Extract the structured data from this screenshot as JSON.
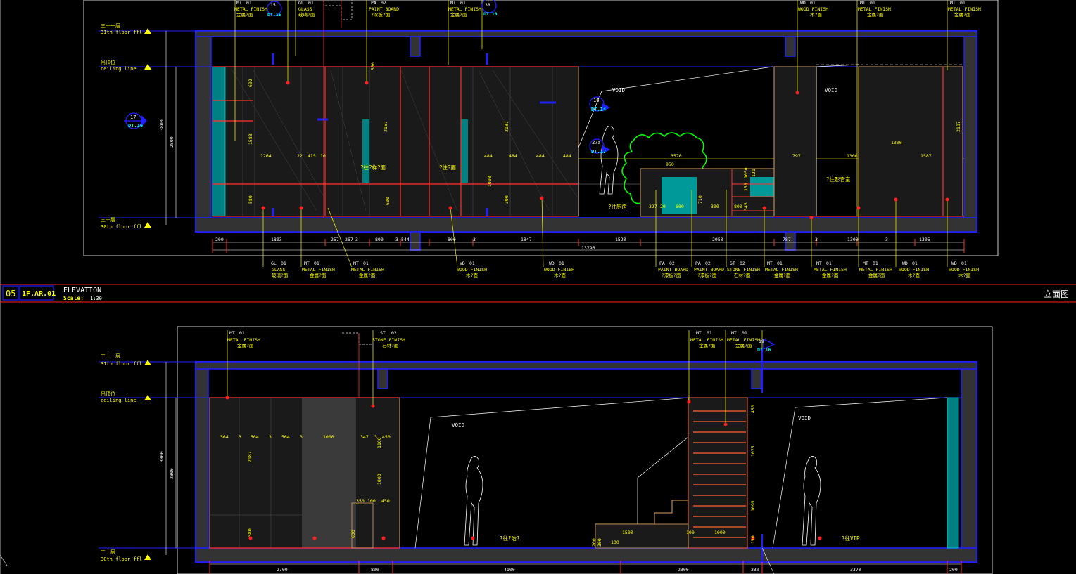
{
  "title_bar": {
    "number": "05",
    "sheet_code": "1F.AR.01",
    "title": "ELEVATION",
    "scale_label": "Scale:",
    "scale_value": "1:30",
    "right_label": "立面图"
  },
  "level_labels": {
    "floor31_cn": "三十一层",
    "floor31_en": "31th floor ffl",
    "ceiling_cn": "吊顶位",
    "ceiling_en": "ceiling line",
    "floor30_cn": "三十层",
    "floor30_en": "30th floor ffl"
  },
  "top": {
    "tags_top": [
      {
        "code": "MT",
        "num": "01",
        "en": "METAL FINISH",
        "cn": "金属?面"
      },
      {
        "code": "15",
        "num": "",
        "en": "DT.15",
        "cn": ""
      },
      {
        "code": "GL",
        "num": "01",
        "en": "GLASS",
        "cn": "玻璃?面"
      },
      {
        "code": "PA",
        "num": "02",
        "en": "PAINT BOARD",
        "cn": "?漆板?面"
      },
      {
        "code": "MT",
        "num": "01",
        "en": "METAL FINISH",
        "cn": "金属?面"
      },
      {
        "code": "38",
        "num": "",
        "en": "DT.19",
        "cn": ""
      },
      {
        "code": "WD",
        "num": "01",
        "en": "WOOD FINISH",
        "cn": "木?面"
      },
      {
        "code": "MT",
        "num": "01",
        "en": "METAL FINISH",
        "cn": "金属?面"
      },
      {
        "code": "MT",
        "num": "01",
        "en": "METAL FINISH",
        "cn": "金属?面"
      }
    ],
    "tags_bottom": [
      {
        "code": "GL",
        "num": "01",
        "en": "GLASS",
        "cn": "玻璃?面"
      },
      {
        "code": "MT",
        "num": "01",
        "en": "METAL FINISH",
        "cn": "金属?面"
      },
      {
        "code": "MT",
        "num": "01",
        "en": "METAL FINISH",
        "cn": "金属?面"
      },
      {
        "code": "WD",
        "num": "01",
        "en": "WOOD FINISH",
        "cn": "木?面"
      },
      {
        "code": "WD",
        "num": "01",
        "en": "WOOD FINISH",
        "cn": "木?面"
      },
      {
        "code": "PA",
        "num": "02",
        "en": "PAINT BOARD",
        "cn": "?漆板?面"
      },
      {
        "code": "PA",
        "num": "02",
        "en": "PAINT BOARD",
        "cn": "?漆板?面"
      },
      {
        "code": "ST",
        "num": "02",
        "en": "STONE FINISH",
        "cn": "石材?面"
      },
      {
        "code": "MT",
        "num": "01",
        "en": "METAL FINISH",
        "cn": "金属?面"
      },
      {
        "code": "MT",
        "num": "01",
        "en": "METAL FINISH",
        "cn": "金属?面"
      },
      {
        "code": "MT",
        "num": "01",
        "en": "METAL FINISH",
        "cn": "金属?面"
      },
      {
        "code": "WD",
        "num": "01",
        "en": "WOOD FINISH",
        "cn": "木?面"
      },
      {
        "code": "WD",
        "num": "01",
        "en": "WOOD FINISH",
        "cn": "木?面"
      }
    ],
    "section_marks": [
      {
        "num": "17",
        "ref": "DT.16"
      },
      {
        "num": "16",
        "ref": "DT.14"
      },
      {
        "num": "27a",
        "ref": "DT.17"
      }
    ],
    "dims_bottom": [
      "200",
      "1803",
      "257",
      "267",
      "3",
      "800",
      "3",
      "544",
      "800",
      "3",
      "1847",
      "1520",
      "2050",
      "787",
      "3",
      "1300",
      "3",
      "1305"
    ],
    "overall_dim": "13796",
    "left_dims": [
      "3800",
      "2800"
    ],
    "inner_dims": [
      "602",
      "1588",
      "1264",
      "22",
      "415",
      "10",
      "2157",
      "2187",
      "484",
      "484",
      "484",
      "484",
      "3570",
      "950",
      "797",
      "1300",
      "1300",
      "1587",
      "2187",
      "1000",
      "300",
      "580",
      "600",
      "530",
      "327",
      "20",
      "600",
      "710",
      "300",
      "800",
      "345",
      "150",
      "1050",
      "121"
    ],
    "void_labels": [
      "VOID",
      "VOID"
    ],
    "room_labels": [
      "?往?梯?面",
      "?往?面",
      "?往厨房",
      "?往影音室"
    ]
  },
  "bottom": {
    "tags_top": [
      {
        "code": "MT",
        "num": "01",
        "en": "METAL FINISH",
        "cn": "金属?面"
      },
      {
        "code": "ST",
        "num": "02",
        "en": "STONE FINISH",
        "cn": "石材?面"
      },
      {
        "code": "MT",
        "num": "01",
        "en": "METAL FINISH",
        "cn": "金属?面"
      },
      {
        "code": "MT",
        "num": "01",
        "en": "METAL FINISH",
        "cn": "金属?面"
      },
      {
        "code": "19",
        "num": "",
        "en": "DT.16",
        "cn": ""
      }
    ],
    "dims_bottom": [
      "2700",
      "800",
      "4100",
      "2300",
      "330",
      "3370",
      "200"
    ],
    "left_dims": [
      "3800",
      "2800"
    ],
    "inner_dims": [
      "564",
      "3",
      "564",
      "3",
      "564",
      "3",
      "1000",
      "347",
      "3",
      "450",
      "2187",
      "1100",
      "1800",
      "350",
      "100",
      "450",
      "580",
      "600",
      "450",
      "1075",
      "1095",
      "1500",
      "1000",
      "100",
      "200",
      "300",
      "100",
      "150"
    ],
    "void_labels": [
      "VOID",
      "VOID"
    ],
    "room_labels": [
      "?往?治?",
      "?往VIP"
    ]
  }
}
